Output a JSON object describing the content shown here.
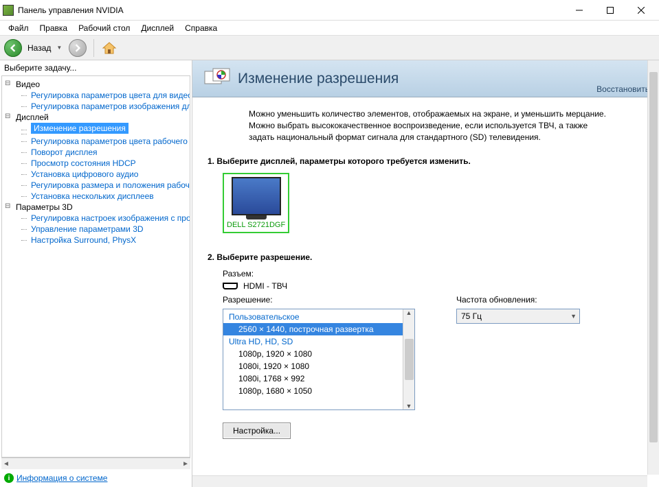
{
  "window": {
    "title": "Панель управления NVIDIA"
  },
  "menu": {
    "file": "Файл",
    "edit": "Правка",
    "desktop": "Рабочий стол",
    "display": "Дисплей",
    "help": "Справка"
  },
  "toolbar": {
    "back": "Назад"
  },
  "sidebar": {
    "prompt": "Выберите задачу...",
    "categories": [
      {
        "label": "Видео",
        "items": [
          "Регулировка параметров цвета для видео",
          "Регулировка параметров изображения для видео"
        ]
      },
      {
        "label": "Дисплей",
        "items": [
          "Изменение разрешения",
          "Регулировка параметров цвета рабочего стола",
          "Поворот дисплея",
          "Просмотр состояния HDCP",
          "Установка цифрового аудио",
          "Регулировка размера и положения рабочего стола",
          "Установка нескольких дисплеев"
        ],
        "selected_index": 0
      },
      {
        "label": "Параметры 3D",
        "items": [
          "Регулировка настроек изображения с просмотром",
          "Управление параметрами 3D",
          "Настройка Surround, PhysX"
        ]
      }
    ],
    "system_info": "Информация о системе"
  },
  "main": {
    "title": "Изменение разрешения",
    "restore": "Восстановить",
    "description": "Можно уменьшить количество элементов, отображаемых на экране, и уменьшить мерцание. Можно выбрать высококачественное воспроизведение, если используется ТВЧ, а также задать национальный формат сигнала для стандартного (SD) телевидения.",
    "step1_label": "1. Выберите дисплей, параметры которого требуется изменить.",
    "monitor_name": "DELL S2721DGF",
    "step2_label": "2. Выберите разрешение.",
    "connector_label": "Разъем:",
    "connector_value": "HDMI - ТВЧ",
    "resolution_label": "Разрешение:",
    "refresh_label": "Частота обновления:",
    "refresh_value": "75 Гц",
    "res_groups": [
      {
        "header": "Пользовательское",
        "items": [
          "2560 × 1440, построчная развертка"
        ],
        "selected_index": 0
      },
      {
        "header": "Ultra HD, HD, SD",
        "items": [
          "1080p, 1920 × 1080",
          "1080i, 1920 × 1080",
          "1080i, 1768 × 992",
          "1080p, 1680 × 1050"
        ]
      }
    ],
    "settings_btn": "Настройка..."
  }
}
